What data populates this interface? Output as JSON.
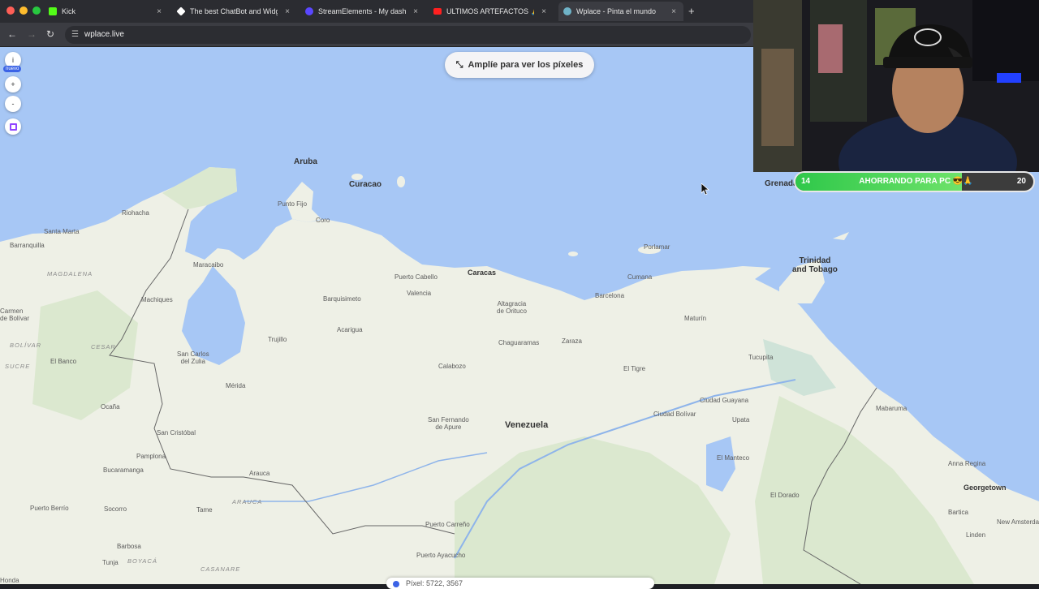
{
  "browser": {
    "tabs": [
      {
        "label": "Kick",
        "icon": "kick-icon",
        "color": "#53fc18"
      },
      {
        "label": "The best ChatBot and Widgets",
        "icon": "diamond-icon",
        "color": "#ffffff"
      },
      {
        "label": "StreamElements - My dashboard",
        "icon": "streamelements-icon",
        "color": "#5a47ff"
      },
      {
        "label": "ULTIMOS ARTEFACTOS 🙏 PRIMEROS",
        "icon": "youtube-icon",
        "color": "#ff2020"
      },
      {
        "label": "Wplace - Pinta el mundo",
        "icon": "wplace-icon",
        "color": "#6fb3c8"
      }
    ],
    "new_tab": "+",
    "url": "wplace.live"
  },
  "map_ui": {
    "info_button": "i",
    "new_badge": "nuevo",
    "zoom_in": "+",
    "zoom_out": "-",
    "zoom_hint": "Amplíe para ver los píxeles",
    "bottom_text": "Píxel: 5722, 3567"
  },
  "map_labels": {
    "aruba": "Aruba",
    "curacao": "Curacao",
    "grenada": "Grenada",
    "trinidad": "Trinidad\nand Tobago",
    "riohacha": "Riohacha",
    "santa_marta": "Santa Marta",
    "barranquilla": "Barranquilla",
    "punto_fijo": "Punto Fijo",
    "coro": "Coro",
    "porlamar": "Porlamar",
    "magdalena": "MAGDALENA",
    "maracaibo": "Maracaibo",
    "puerto_cabello": "Puerto Cabello",
    "caracas": "Caracas",
    "cumana": "Cumana",
    "carmen": "Carmen\nde Bolívar",
    "machiques": "Machiques",
    "barquisimeto": "Barquisimeto",
    "valencia": "Valencia",
    "altagracia": "Altagracia\nde Orituco",
    "barcelona": "Barcelona",
    "maturin": "Maturín",
    "bolivar_dept": "BOLÍVAR",
    "cesar": "CESAR",
    "acarigua": "Acarigua",
    "trujillo": "Trujillo",
    "chaguaramas": "Chaguaramas",
    "zaraza": "Zaraza",
    "tucupita": "Tucupita",
    "sucre": "SUCRE",
    "san_carlos": "San Carlos\ndel Zulia",
    "calabozo": "Calabozo",
    "el_tigre": "El Tigre",
    "el_banco": "El Banco",
    "merida": "Mérida",
    "ciudad_guayana": "Ciudad Guayana",
    "mabaruma": "Mabaruma",
    "ocana": "Ocaña",
    "ciudad_bolivar": "Ciudad Bolívar",
    "upata": "Upata",
    "san_fernando": "San Fernando\nde Apure",
    "venezuela": "Venezuela",
    "san_cristobal": "San Cristóbal",
    "pamplona": "Pamplona",
    "el_manteco": "El Manteco",
    "arauca": "Arauca",
    "bucaramanga": "Bucaramanga",
    "anna_regina": "Anna Regina",
    "georgetown": "Georgetown",
    "el_dorado": "El Dorado",
    "arauca_dept": "ARAUCA",
    "puerto_berrio": "Puerto Berrío",
    "socorro": "Socorro",
    "tame": "Tame",
    "bartica": "Bartica",
    "new_amsterdam": "New Amsterdam",
    "puerto_carreno": "Puerto Carreño",
    "linden": "Linden",
    "barbosa": "Barbosa",
    "boyaca": "BOYACÁ",
    "tunja": "Tunja",
    "casanare": "CASANARE",
    "puerto_ayacucho": "Puerto Ayacucho",
    "honda": "Honda"
  },
  "goal": {
    "current": "14",
    "title": "AHORRANDO PARA PC 😎🙏",
    "target": "20",
    "progress": 0.7
  },
  "colors": {
    "sea": "#a7c7f5",
    "land": "#eef0e6",
    "forest": "#dbe8cf",
    "accent": "#3b63e6",
    "goal_green": "#2fc84a"
  }
}
